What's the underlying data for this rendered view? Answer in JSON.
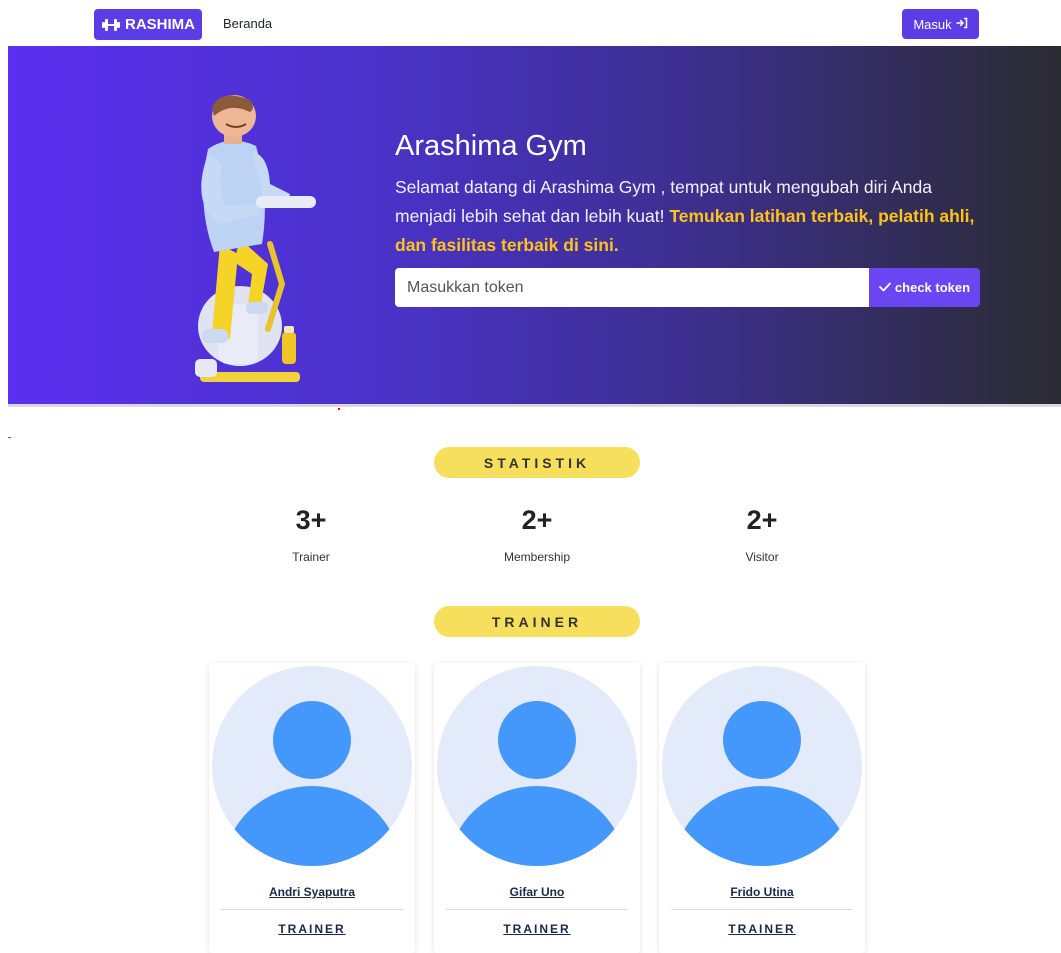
{
  "navbar": {
    "brand": "RASHIMA",
    "links": [
      {
        "label": "Beranda"
      }
    ],
    "login_label": "Masuk"
  },
  "hero": {
    "title": "Arashima Gym",
    "text_plain": "Selamat datang di Arashima Gym , tempat untuk mengubah diri Anda menjadi lebih sehat dan lebih kuat! ",
    "text_highlight": "Temukan latihan terbaik, pelatih ahli, dan fasilitas terbaik di sini.",
    "token_placeholder": "Masukkan token",
    "check_label": "check token"
  },
  "statistics": {
    "heading": "STATISTIK",
    "items": [
      {
        "value": "3+",
        "label": "Trainer"
      },
      {
        "value": "2+",
        "label": "Membership"
      },
      {
        "value": "2+",
        "label": "Visitor"
      }
    ]
  },
  "trainers": {
    "heading": "TRAINER",
    "items": [
      {
        "name": "Andri Syaputra",
        "role": "TRAINER"
      },
      {
        "name": "Gifar Uno",
        "role": "TRAINER"
      },
      {
        "name": "Frido Utina",
        "role": "TRAINER"
      }
    ]
  },
  "colors": {
    "primary": "#5b3de8",
    "highlight": "#ffc21a",
    "pill": "#f6df5c",
    "avatar_bg": "#e3ebfb",
    "avatar_fg": "#4598fb"
  }
}
